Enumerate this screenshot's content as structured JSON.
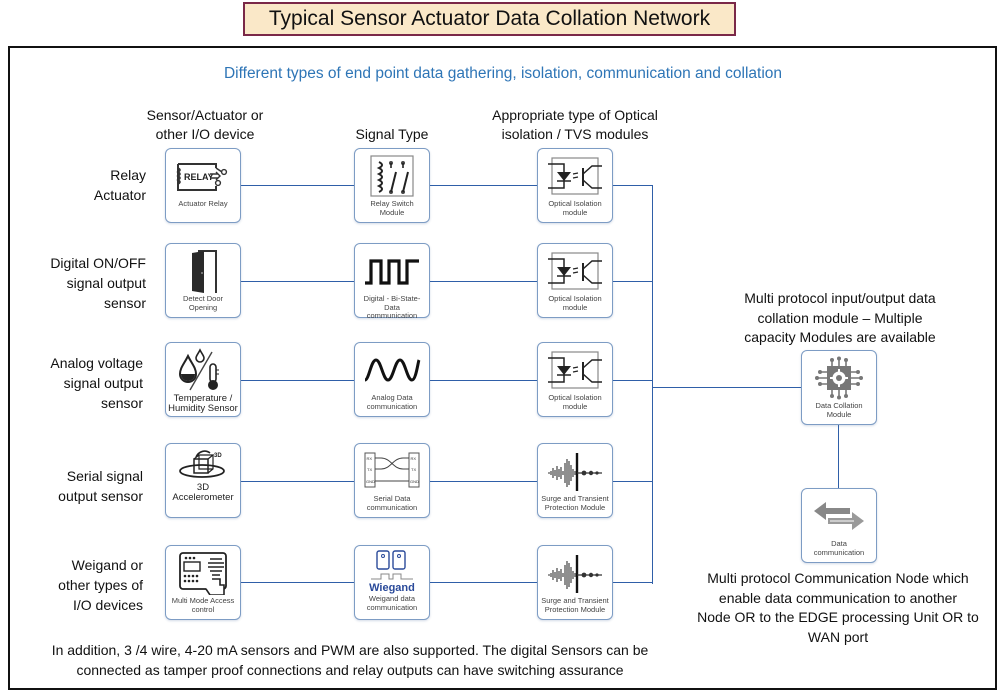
{
  "title": "Typical Sensor Actuator Data Collation Network",
  "subtitle": "Different types of end point data gathering, isolation, communication and collation",
  "column_headers": {
    "devices": [
      "Sensor/Actuator or",
      "other I/O device"
    ],
    "signal": [
      "Signal Type"
    ],
    "isolation": [
      "Appropriate type of Optical",
      "isolation / TVS modules"
    ]
  },
  "rows": [
    {
      "label": [
        "Relay",
        "Actuator"
      ],
      "device": {
        "icon": "relay-icon",
        "caption": [
          "Actuator Relay"
        ]
      },
      "signal": {
        "icon": "relay-switch-icon",
        "caption": [
          "Relay Switch",
          "Module"
        ]
      },
      "isolation": {
        "icon": "optocoupler-icon",
        "caption": [
          "Optical Isolation",
          "module"
        ]
      }
    },
    {
      "label": [
        "Digital ON/OFF",
        "signal output",
        "sensor"
      ],
      "device": {
        "icon": "door-icon",
        "caption": [
          "Detect Door",
          "Opening"
        ]
      },
      "signal": {
        "icon": "square-wave-icon",
        "caption": [
          "Digital - Bi-State-",
          "Data",
          "communication"
        ]
      },
      "isolation": {
        "icon": "optocoupler-icon",
        "caption": [
          "Optical Isolation",
          "module"
        ]
      }
    },
    {
      "label": [
        "Analog voltage",
        "signal output",
        "sensor"
      ],
      "device": {
        "icon": "temperature-humidity-icon",
        "caption": [
          "Temperature /",
          "Humidity Sensor"
        ]
      },
      "signal": {
        "icon": "sine-wave-icon",
        "caption": [
          "Analog Data",
          "communication"
        ]
      },
      "isolation": {
        "icon": "optocoupler-icon",
        "caption": [
          "Optical Isolation",
          "module"
        ]
      }
    },
    {
      "label": [
        "Serial signal",
        "output sensor"
      ],
      "device": {
        "icon": "accelerometer-3d-icon",
        "caption": [
          "3D",
          "Accelerometer"
        ],
        "icon_text": "3D"
      },
      "signal": {
        "icon": "serial-rx-tx-icon",
        "caption": [
          "Serial Data",
          "communication"
        ],
        "pins": [
          "RX",
          "TX",
          "GND"
        ]
      },
      "isolation": {
        "icon": "surge-waveform-icon",
        "caption": [
          "Surge and Transient",
          "Protection Module"
        ]
      }
    },
    {
      "label": [
        "Weigand or",
        "other types of",
        "I/O  devices"
      ],
      "device": {
        "icon": "access-control-keypad-icon",
        "caption": [
          "Multi Mode Access",
          "control"
        ]
      },
      "signal": {
        "icon": "wiegand-icon",
        "caption": [
          "Weigand data",
          "communication"
        ],
        "brand": "Wiegand"
      },
      "isolation": {
        "icon": "surge-waveform-icon",
        "caption": [
          "Surge and Transient",
          "Protection Module"
        ]
      }
    }
  ],
  "collation": {
    "description": [
      "Multi protocol input/output data",
      "collation module – Multiple",
      "capacity Modules are available"
    ],
    "icon": "chip-gear-icon",
    "caption": [
      "Data Collation",
      "Module"
    ]
  },
  "communication": {
    "icon": "bidirectional-arrows-icon",
    "caption": [
      "Data",
      "communication"
    ],
    "description": [
      "Multi protocol Communication Node which",
      "enable data communication to another",
      "Node OR to the EDGE processing Unit OR to",
      "WAN port"
    ]
  },
  "footnote": [
    "In addition, 3 /4 wire, 4-20 mA sensors and PWM are also supported.  The digital Sensors  can be",
    "connected as tamper proof connections and relay outputs can have switching assurance"
  ],
  "colors": {
    "subtitle": "#2e75b6",
    "wire": "#2f5fa8",
    "title_bg": "#fae8c8",
    "title_border": "#7a2848",
    "wiegand_brand": "#2a4a9a"
  }
}
